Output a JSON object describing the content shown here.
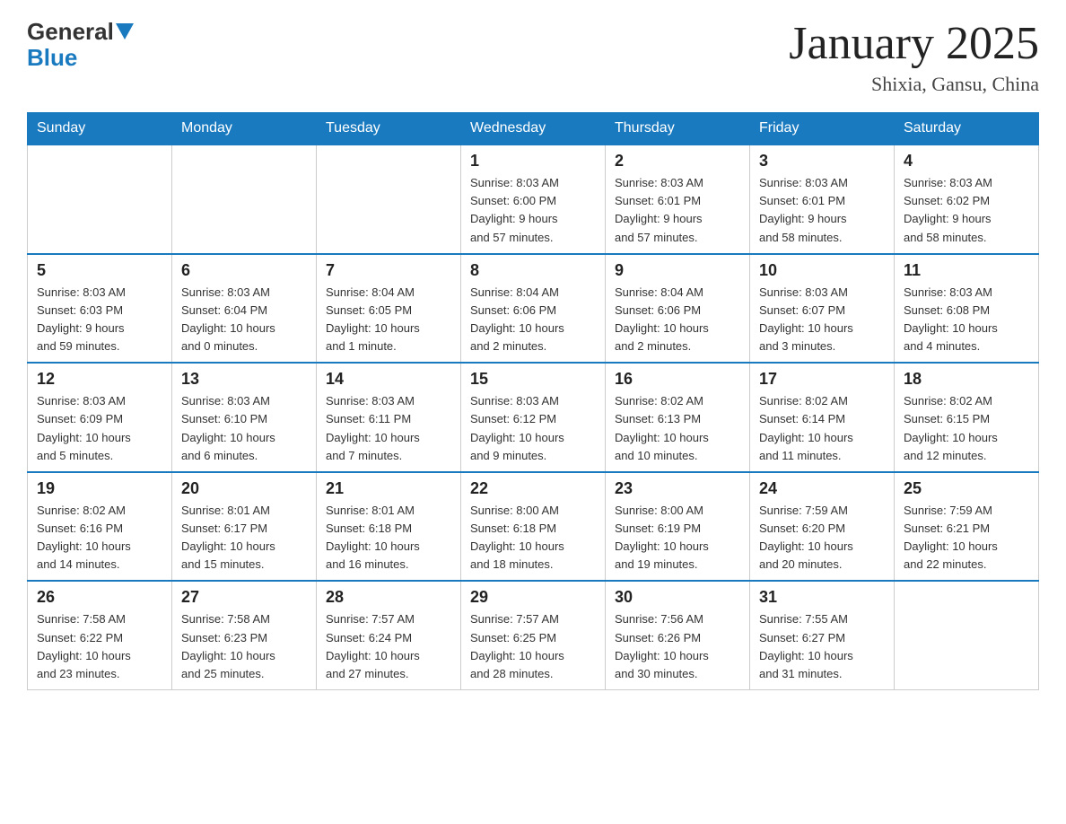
{
  "header": {
    "logo_general": "General",
    "logo_blue": "Blue",
    "month_title": "January 2025",
    "location": "Shixia, Gansu, China"
  },
  "days_of_week": [
    "Sunday",
    "Monday",
    "Tuesday",
    "Wednesday",
    "Thursday",
    "Friday",
    "Saturday"
  ],
  "weeks": [
    [
      {
        "day": "",
        "info": ""
      },
      {
        "day": "",
        "info": ""
      },
      {
        "day": "",
        "info": ""
      },
      {
        "day": "1",
        "info": "Sunrise: 8:03 AM\nSunset: 6:00 PM\nDaylight: 9 hours\nand 57 minutes."
      },
      {
        "day": "2",
        "info": "Sunrise: 8:03 AM\nSunset: 6:01 PM\nDaylight: 9 hours\nand 57 minutes."
      },
      {
        "day": "3",
        "info": "Sunrise: 8:03 AM\nSunset: 6:01 PM\nDaylight: 9 hours\nand 58 minutes."
      },
      {
        "day": "4",
        "info": "Sunrise: 8:03 AM\nSunset: 6:02 PM\nDaylight: 9 hours\nand 58 minutes."
      }
    ],
    [
      {
        "day": "5",
        "info": "Sunrise: 8:03 AM\nSunset: 6:03 PM\nDaylight: 9 hours\nand 59 minutes."
      },
      {
        "day": "6",
        "info": "Sunrise: 8:03 AM\nSunset: 6:04 PM\nDaylight: 10 hours\nand 0 minutes."
      },
      {
        "day": "7",
        "info": "Sunrise: 8:04 AM\nSunset: 6:05 PM\nDaylight: 10 hours\nand 1 minute."
      },
      {
        "day": "8",
        "info": "Sunrise: 8:04 AM\nSunset: 6:06 PM\nDaylight: 10 hours\nand 2 minutes."
      },
      {
        "day": "9",
        "info": "Sunrise: 8:04 AM\nSunset: 6:06 PM\nDaylight: 10 hours\nand 2 minutes."
      },
      {
        "day": "10",
        "info": "Sunrise: 8:03 AM\nSunset: 6:07 PM\nDaylight: 10 hours\nand 3 minutes."
      },
      {
        "day": "11",
        "info": "Sunrise: 8:03 AM\nSunset: 6:08 PM\nDaylight: 10 hours\nand 4 minutes."
      }
    ],
    [
      {
        "day": "12",
        "info": "Sunrise: 8:03 AM\nSunset: 6:09 PM\nDaylight: 10 hours\nand 5 minutes."
      },
      {
        "day": "13",
        "info": "Sunrise: 8:03 AM\nSunset: 6:10 PM\nDaylight: 10 hours\nand 6 minutes."
      },
      {
        "day": "14",
        "info": "Sunrise: 8:03 AM\nSunset: 6:11 PM\nDaylight: 10 hours\nand 7 minutes."
      },
      {
        "day": "15",
        "info": "Sunrise: 8:03 AM\nSunset: 6:12 PM\nDaylight: 10 hours\nand 9 minutes."
      },
      {
        "day": "16",
        "info": "Sunrise: 8:02 AM\nSunset: 6:13 PM\nDaylight: 10 hours\nand 10 minutes."
      },
      {
        "day": "17",
        "info": "Sunrise: 8:02 AM\nSunset: 6:14 PM\nDaylight: 10 hours\nand 11 minutes."
      },
      {
        "day": "18",
        "info": "Sunrise: 8:02 AM\nSunset: 6:15 PM\nDaylight: 10 hours\nand 12 minutes."
      }
    ],
    [
      {
        "day": "19",
        "info": "Sunrise: 8:02 AM\nSunset: 6:16 PM\nDaylight: 10 hours\nand 14 minutes."
      },
      {
        "day": "20",
        "info": "Sunrise: 8:01 AM\nSunset: 6:17 PM\nDaylight: 10 hours\nand 15 minutes."
      },
      {
        "day": "21",
        "info": "Sunrise: 8:01 AM\nSunset: 6:18 PM\nDaylight: 10 hours\nand 16 minutes."
      },
      {
        "day": "22",
        "info": "Sunrise: 8:00 AM\nSunset: 6:18 PM\nDaylight: 10 hours\nand 18 minutes."
      },
      {
        "day": "23",
        "info": "Sunrise: 8:00 AM\nSunset: 6:19 PM\nDaylight: 10 hours\nand 19 minutes."
      },
      {
        "day": "24",
        "info": "Sunrise: 7:59 AM\nSunset: 6:20 PM\nDaylight: 10 hours\nand 20 minutes."
      },
      {
        "day": "25",
        "info": "Sunrise: 7:59 AM\nSunset: 6:21 PM\nDaylight: 10 hours\nand 22 minutes."
      }
    ],
    [
      {
        "day": "26",
        "info": "Sunrise: 7:58 AM\nSunset: 6:22 PM\nDaylight: 10 hours\nand 23 minutes."
      },
      {
        "day": "27",
        "info": "Sunrise: 7:58 AM\nSunset: 6:23 PM\nDaylight: 10 hours\nand 25 minutes."
      },
      {
        "day": "28",
        "info": "Sunrise: 7:57 AM\nSunset: 6:24 PM\nDaylight: 10 hours\nand 27 minutes."
      },
      {
        "day": "29",
        "info": "Sunrise: 7:57 AM\nSunset: 6:25 PM\nDaylight: 10 hours\nand 28 minutes."
      },
      {
        "day": "30",
        "info": "Sunrise: 7:56 AM\nSunset: 6:26 PM\nDaylight: 10 hours\nand 30 minutes."
      },
      {
        "day": "31",
        "info": "Sunrise: 7:55 AM\nSunset: 6:27 PM\nDaylight: 10 hours\nand 31 minutes."
      },
      {
        "day": "",
        "info": ""
      }
    ]
  ]
}
